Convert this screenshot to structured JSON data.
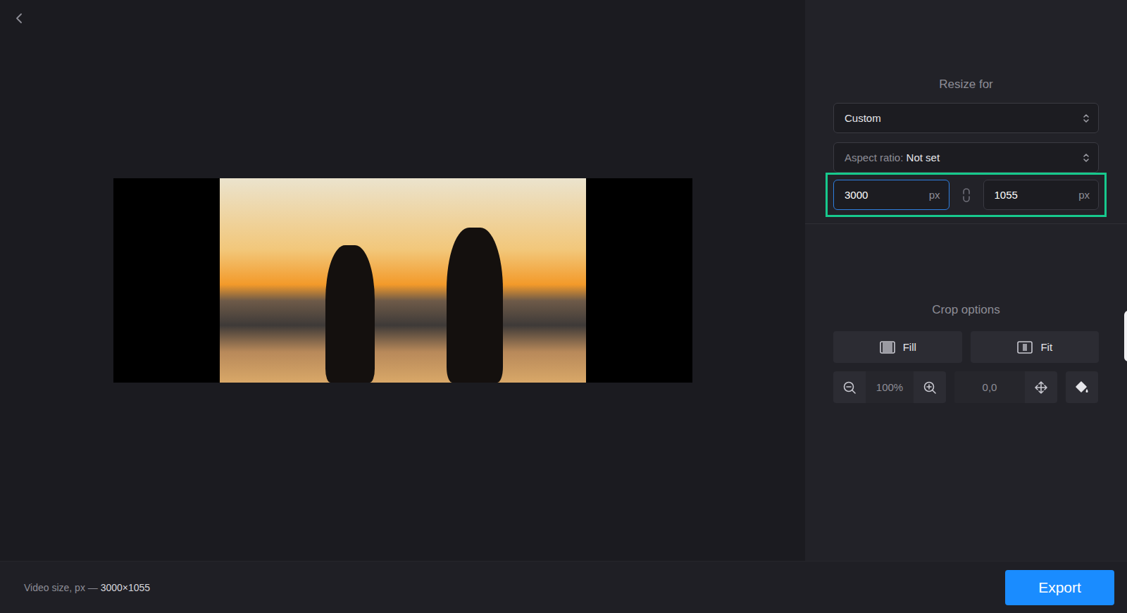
{
  "panel": {
    "title": "Resize for",
    "preset": "Custom",
    "aspect_label": "Aspect ratio:",
    "aspect_value": "Not set",
    "width": {
      "value": "3000",
      "unit": "px",
      "focused": true
    },
    "height": {
      "value": "1055",
      "unit": "px",
      "focused": false
    },
    "linked": false
  },
  "crop": {
    "title": "Crop options",
    "modes": [
      {
        "label": "Fill",
        "selected": false
      },
      {
        "label": "Fit",
        "selected": false
      }
    ],
    "zoom": "100%",
    "offset": "0,0"
  },
  "status_bar": {
    "label": "Video size, px —",
    "value": "3000×1055"
  },
  "export_button": "Export"
}
